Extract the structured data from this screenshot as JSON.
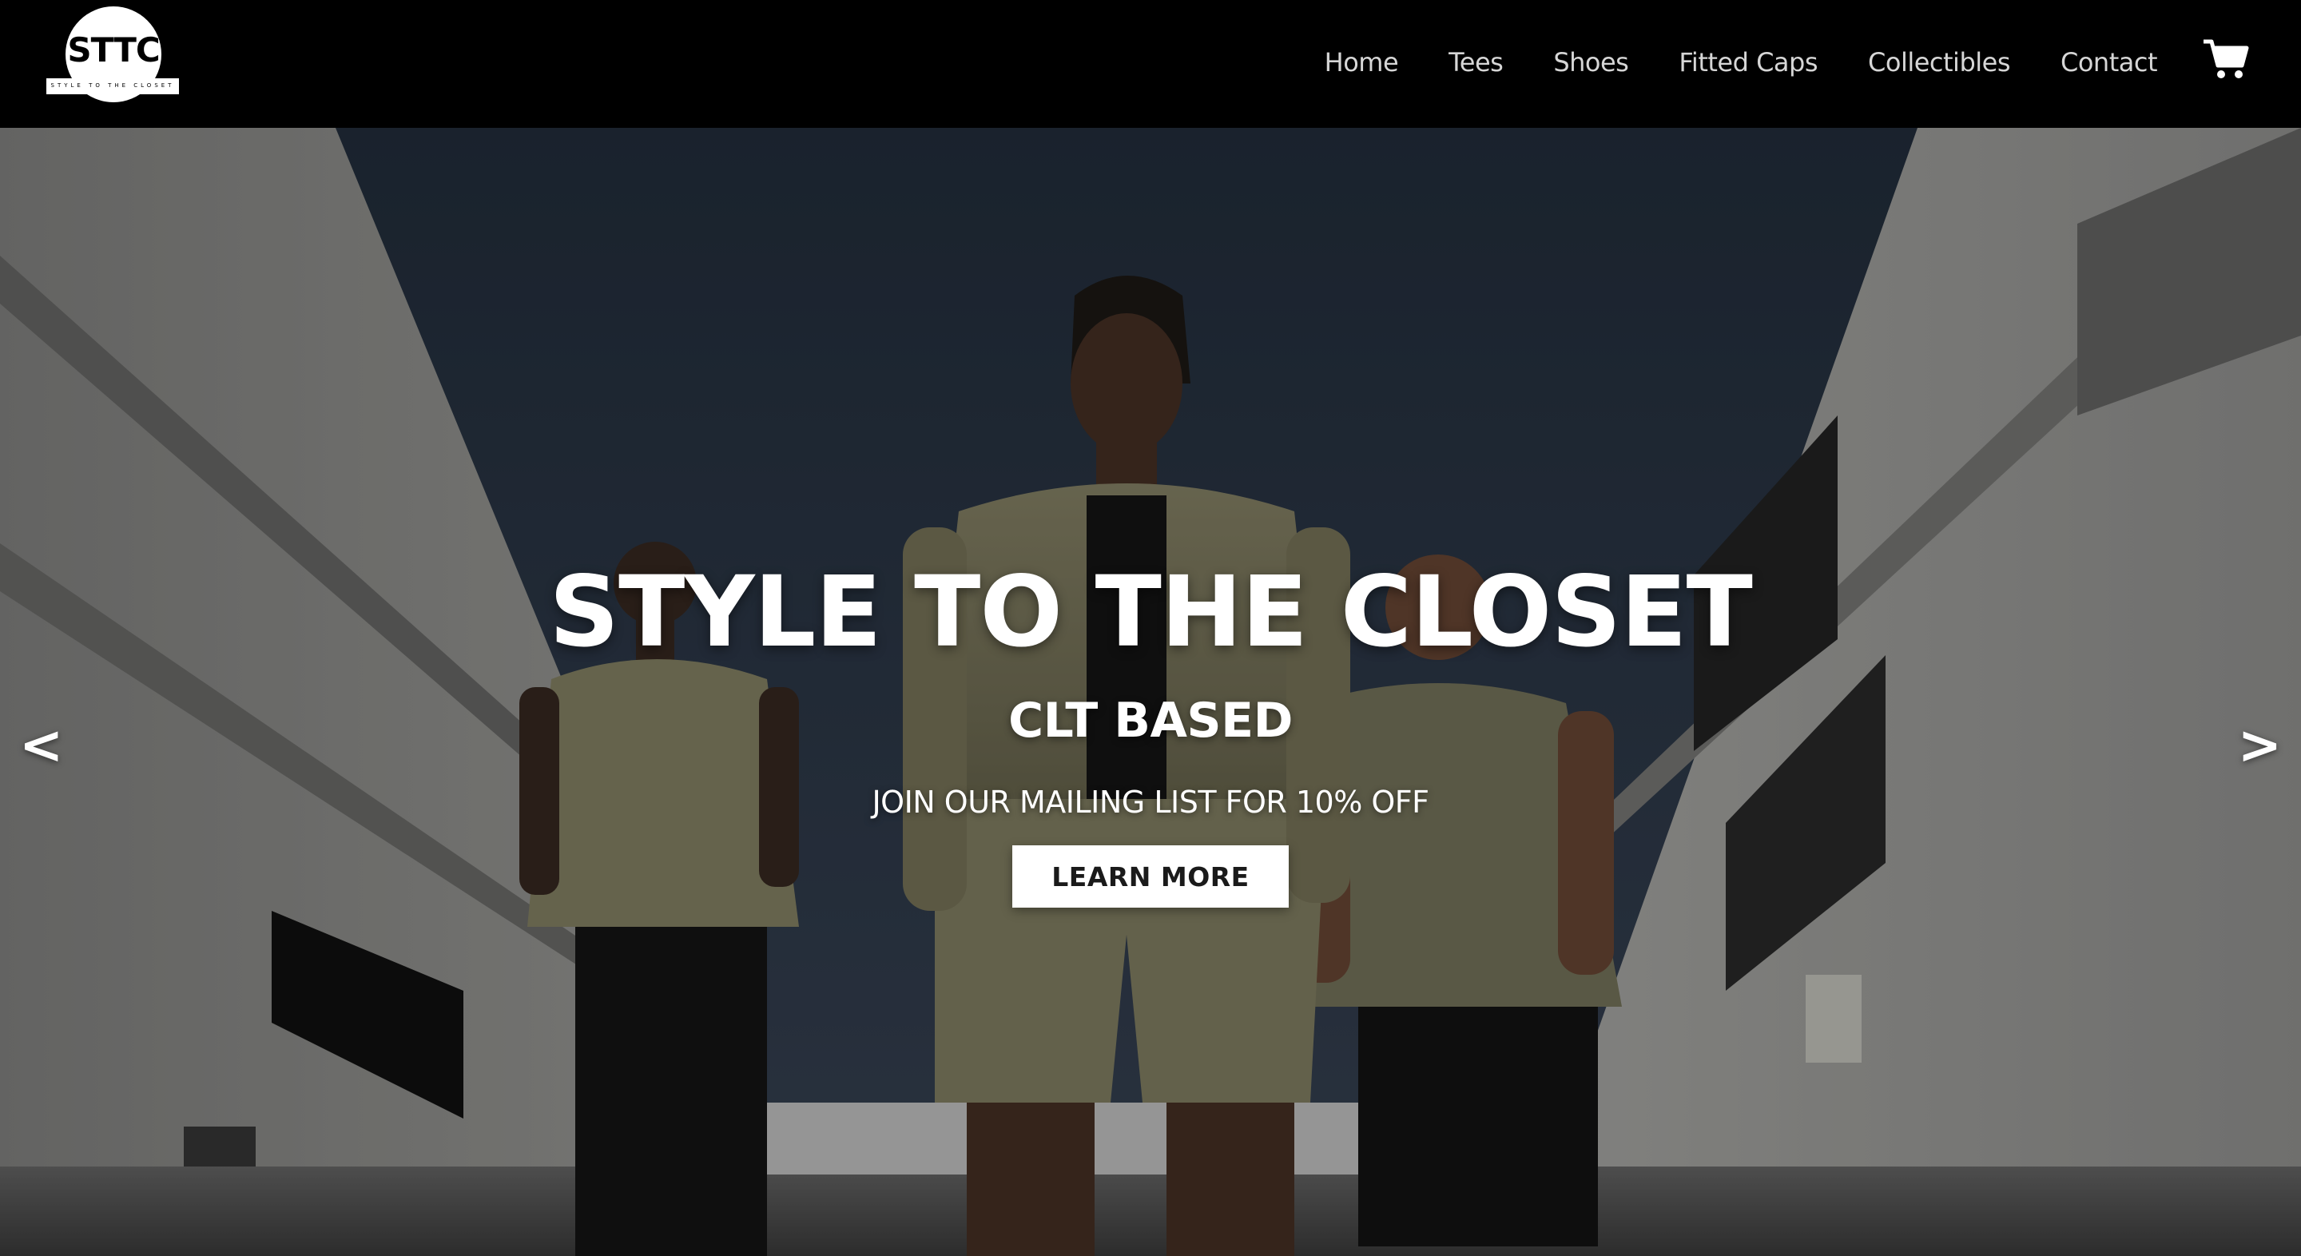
{
  "brand": {
    "logo_text": "STTC",
    "logo_tagline": "STYLE TO THE CLOSET"
  },
  "nav": {
    "items": [
      {
        "label": "Home"
      },
      {
        "label": "Tees"
      },
      {
        "label": "Shoes"
      },
      {
        "label": "Fitted Caps"
      },
      {
        "label": "Collectibles"
      },
      {
        "label": "Contact"
      }
    ],
    "cart_icon": "shopping-cart-icon"
  },
  "hero": {
    "title": "STYLE TO THE CLOSET",
    "subtitle": "CLT BASED",
    "promo": "JOIN OUR MAILING LIST FOR 10% OFF",
    "button_label": "LEARN MORE",
    "prev_label": "<",
    "next_label": ">"
  },
  "colors": {
    "nav_bg": "#000000",
    "nav_text": "#d6d6d6",
    "hero_text": "#ffffff",
    "button_bg": "#ffffff",
    "button_text": "#1a1a1a",
    "sky": "#2a3242"
  }
}
